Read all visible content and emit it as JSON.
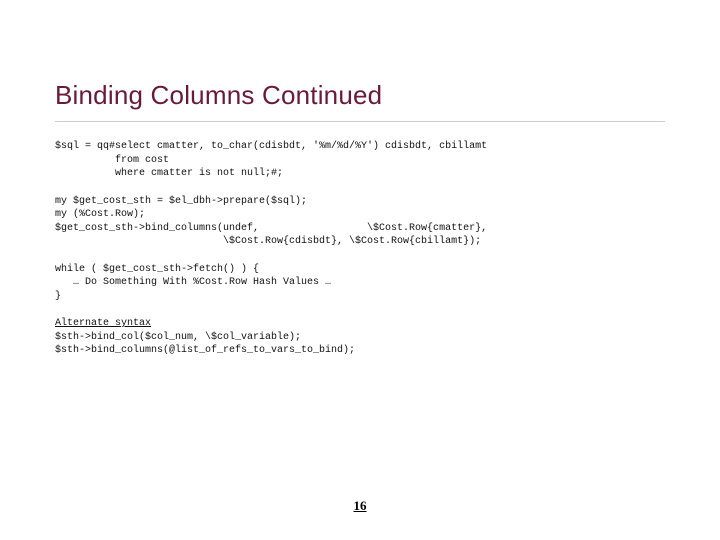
{
  "title": "Binding Columns Continued",
  "code": {
    "sql_block": "$sql = qq#select cmatter, to_char(cdisbdt, '%m/%d/%Y') cdisbdt, cbillamt\n          from cost\n          where cmatter is not null;#;",
    "prepare_block": "my $get_cost_sth = $el_dbh->prepare($sql);\nmy (%Cost.Row);\n$get_cost_sth->bind_columns(undef,                  \\$Cost.Row{cmatter},\n                            \\$Cost.Row{cdisbdt}, \\$Cost.Row{cbillamt});",
    "loop_block": "while ( $get_cost_sth->fetch() ) {\n   … Do Something With %Cost.Row Hash Values …\n}",
    "alt_label": "Alternate syntax",
    "alt_block": "$sth->bind_col($col_num, \\$col_variable);\n$sth->bind_columns(@list_of_refs_to_vars_to_bind);"
  },
  "page_number": "16"
}
